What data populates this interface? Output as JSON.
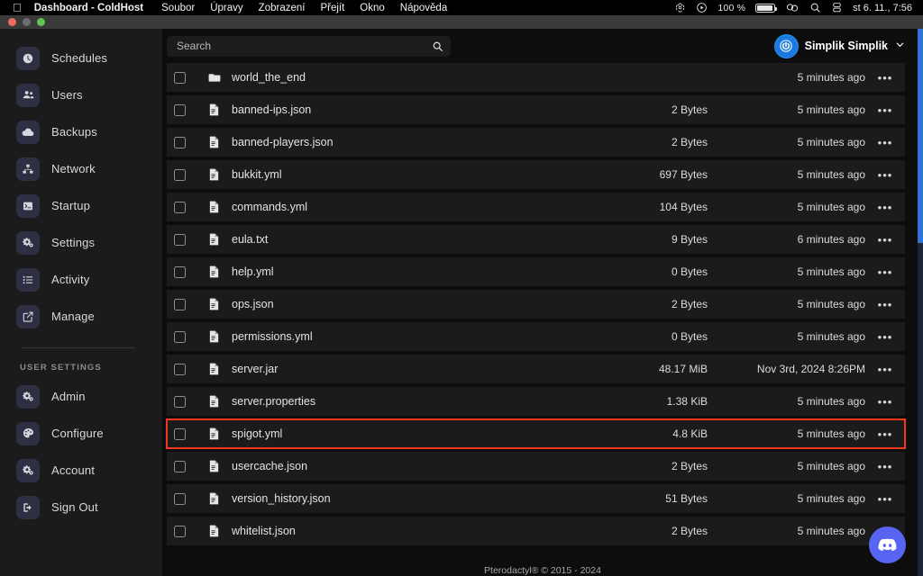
{
  "menubar": {
    "apple_glyph": "",
    "app_title": "Dashboard - ColdHost",
    "items": [
      "Soubor",
      "Úpravy",
      "Zobrazení",
      "Přejít",
      "Okno",
      "Nápověda"
    ],
    "battery_percent": "100 %",
    "clock": "st 6. 11., 7:56"
  },
  "window": {
    "traffic_lights": [
      "close",
      "minimize",
      "zoom"
    ]
  },
  "sidebar": {
    "items": [
      {
        "label": "Schedules",
        "icon": "clock-icon"
      },
      {
        "label": "Users",
        "icon": "users-icon"
      },
      {
        "label": "Backups",
        "icon": "cloud-icon"
      },
      {
        "label": "Network",
        "icon": "network-icon"
      },
      {
        "label": "Startup",
        "icon": "terminal-icon"
      },
      {
        "label": "Settings",
        "icon": "gears-icon"
      },
      {
        "label": "Activity",
        "icon": "list-icon"
      },
      {
        "label": "Manage",
        "icon": "edit-icon"
      }
    ],
    "user_settings_title": "USER SETTINGS",
    "user_items": [
      {
        "label": "Admin",
        "icon": "gears-icon"
      },
      {
        "label": "Configure",
        "icon": "palette-icon"
      },
      {
        "label": "Account",
        "icon": "gears-icon"
      },
      {
        "label": "Sign Out",
        "icon": "sign-out-icon"
      }
    ]
  },
  "topbar": {
    "search_placeholder": "Search",
    "search_value": "",
    "user_name": "Simplik Simplik",
    "caret": "⌄"
  },
  "filelist": {
    "rows": [
      {
        "name": "world_the_end",
        "type": "folder",
        "size": "",
        "time": "5 minutes ago",
        "menu": "•••",
        "highlighted": false
      },
      {
        "name": "banned-ips.json",
        "type": "file",
        "size": "2 Bytes",
        "time": "5 minutes ago",
        "menu": "•••",
        "highlighted": false
      },
      {
        "name": "banned-players.json",
        "type": "file",
        "size": "2 Bytes",
        "time": "5 minutes ago",
        "menu": "•••",
        "highlighted": false
      },
      {
        "name": "bukkit.yml",
        "type": "file",
        "size": "697 Bytes",
        "time": "5 minutes ago",
        "menu": "•••",
        "highlighted": false
      },
      {
        "name": "commands.yml",
        "type": "file",
        "size": "104 Bytes",
        "time": "5 minutes ago",
        "menu": "•••",
        "highlighted": false
      },
      {
        "name": "eula.txt",
        "type": "file",
        "size": "9 Bytes",
        "time": "6 minutes ago",
        "menu": "•••",
        "highlighted": false
      },
      {
        "name": "help.yml",
        "type": "file",
        "size": "0 Bytes",
        "time": "5 minutes ago",
        "menu": "•••",
        "highlighted": false
      },
      {
        "name": "ops.json",
        "type": "file",
        "size": "2 Bytes",
        "time": "5 minutes ago",
        "menu": "•••",
        "highlighted": false
      },
      {
        "name": "permissions.yml",
        "type": "file",
        "size": "0 Bytes",
        "time": "5 minutes ago",
        "menu": "•••",
        "highlighted": false
      },
      {
        "name": "server.jar",
        "type": "file",
        "size": "48.17 MiB",
        "time": "Nov 3rd, 2024 8:26PM",
        "menu": "•••",
        "highlighted": false
      },
      {
        "name": "server.properties",
        "type": "file",
        "size": "1.38 KiB",
        "time": "5 minutes ago",
        "menu": "•••",
        "highlighted": false
      },
      {
        "name": "spigot.yml",
        "type": "file",
        "size": "4.8 KiB",
        "time": "5 minutes ago",
        "menu": "•••",
        "highlighted": true
      },
      {
        "name": "usercache.json",
        "type": "file",
        "size": "2 Bytes",
        "time": "5 minutes ago",
        "menu": "•••",
        "highlighted": false
      },
      {
        "name": "version_history.json",
        "type": "file",
        "size": "51 Bytes",
        "time": "5 minutes ago",
        "menu": "•••",
        "highlighted": false
      },
      {
        "name": "whitelist.json",
        "type": "file",
        "size": "2 Bytes",
        "time": "5 minutes ago",
        "menu": "•••",
        "highlighted": false
      }
    ]
  },
  "footer": {
    "text": "Pterodactyl® © 2015 - 2024"
  },
  "fab": {
    "icon": "discord-icon"
  },
  "colors": {
    "accent_blue": "#2f73d6",
    "avatar_blue": "#1b7ae0",
    "discord": "#5865f2",
    "highlight_red": "#f4371f",
    "sidebar_bg": "#1b1b1b",
    "row_bg": "#1b1b1b",
    "page_bg": "#0d0d0d"
  }
}
